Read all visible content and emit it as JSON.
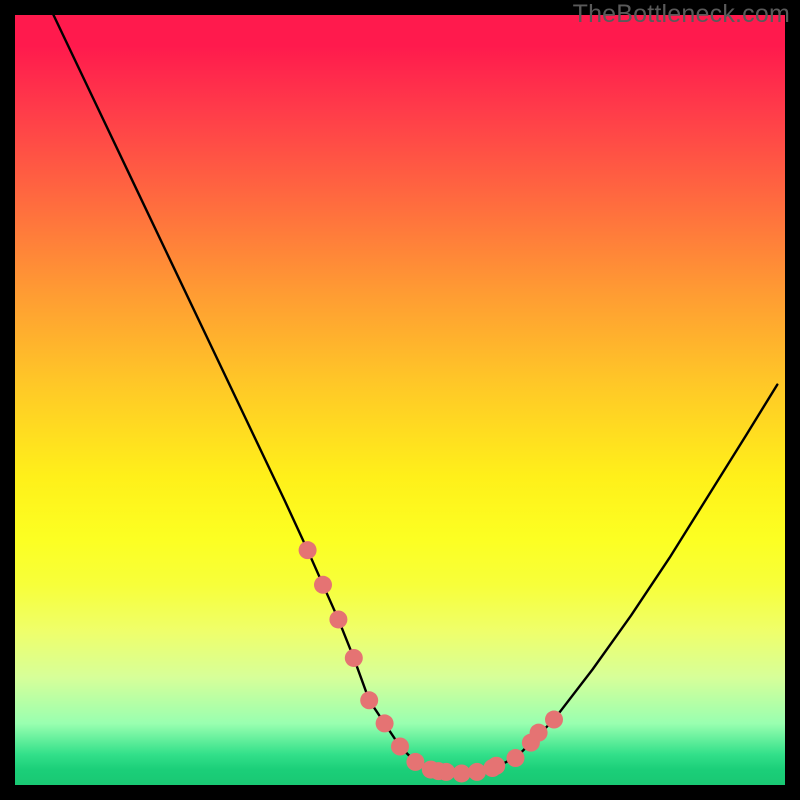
{
  "watermark": "TheBottleneck.com",
  "chart_data": {
    "type": "line",
    "title": "",
    "xlabel": "",
    "ylabel": "",
    "xlim": [
      0,
      100
    ],
    "ylim": [
      0,
      100
    ],
    "grid": false,
    "curve": {
      "x": [
        5,
        10,
        15,
        20,
        25,
        30,
        35,
        38,
        40,
        42,
        44,
        46,
        48,
        50,
        52,
        54,
        56,
        58,
        60,
        62,
        65,
        70,
        75,
        80,
        85,
        90,
        95,
        99
      ],
      "y_pct": [
        100,
        89.5,
        79,
        68.5,
        58,
        47.5,
        37,
        30.5,
        26,
        21.5,
        16.5,
        11,
        8,
        5,
        3,
        2,
        1.7,
        1.5,
        1.7,
        2.2,
        3.5,
        8.5,
        15,
        22,
        29.5,
        37.5,
        45.5,
        52
      ]
    },
    "markers": {
      "x": [
        38,
        40,
        42,
        44,
        46,
        48,
        50,
        52,
        54,
        55,
        56,
        58,
        60,
        62,
        62.5,
        65,
        67,
        68,
        70
      ],
      "y_pct": [
        30.5,
        26,
        21.5,
        16.5,
        11,
        8,
        5,
        3,
        2,
        1.8,
        1.7,
        1.5,
        1.7,
        2.2,
        2.5,
        3.5,
        5.5,
        6.8,
        8.5
      ]
    },
    "marker_style": {
      "color": "#e57373",
      "radius_px": 9
    }
  }
}
